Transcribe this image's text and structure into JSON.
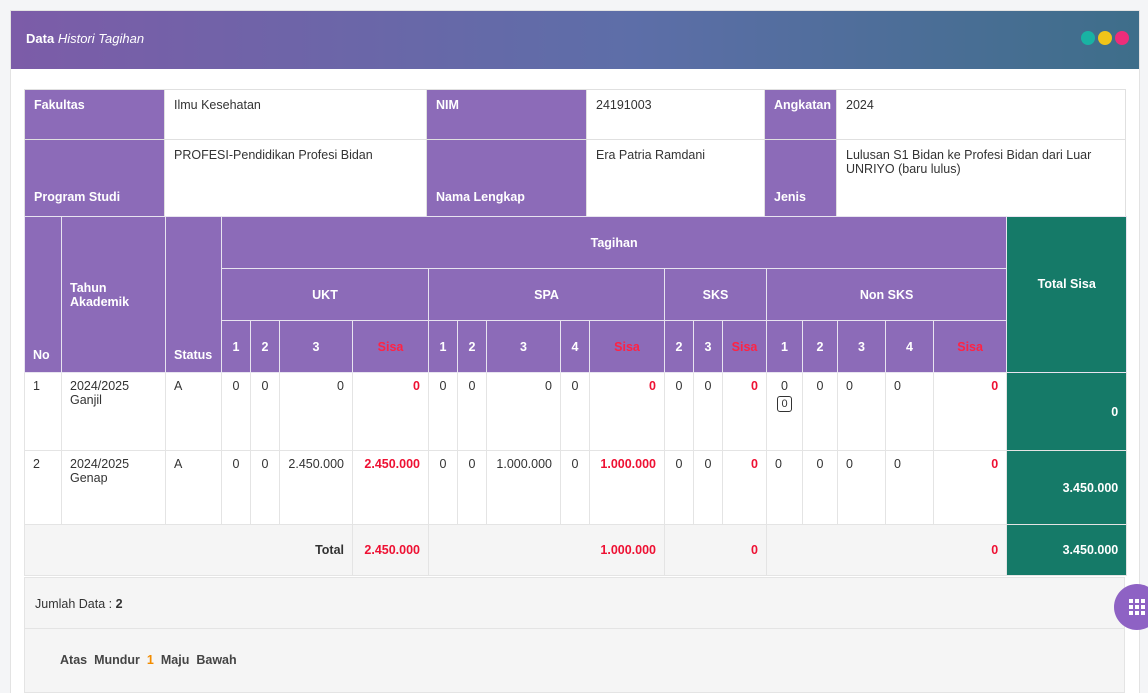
{
  "header": {
    "title_bold": "Data",
    "title_italic": "Histori Tagihan"
  },
  "colors": {
    "dot1": "#19b3a3",
    "dot2": "#f0c419",
    "dot3": "#ee2d7a",
    "header_purple": "#8c6bb8",
    "green": "#157a68",
    "red": "#ee1133",
    "pager_active": "#f28c00"
  },
  "info": {
    "fakultas_label": "Fakultas",
    "fakultas_value": "Ilmu Kesehatan",
    "nim_label": "NIM",
    "nim_value": "24191003",
    "angkatan_label": "Angkatan",
    "angkatan_value": "2024",
    "prodi_label": "Program Studi",
    "prodi_value": "PROFESI-Pendidikan Profesi Bidan",
    "nama_label": "Nama Lengkap",
    "nama_value": "Era Patria Ramdani",
    "jenis_label": "Jenis",
    "jenis_value": "Lulusan S1 Bidan ke Profesi Bidan dari Luar UNRIYO (baru lulus)"
  },
  "table": {
    "h_no": "No",
    "h_tahun": "Tahun Akademik",
    "h_status": "Status",
    "h_tagihan": "Tagihan",
    "h_total_sisa": "Total Sisa",
    "h_ukt": "UKT",
    "h_spa": "SPA",
    "h_sks": "SKS",
    "h_nonsks": "Non SKS",
    "ukt_cols": [
      "1",
      "2",
      "3",
      "Sisa"
    ],
    "spa_cols": [
      "1",
      "2",
      "3",
      "4",
      "Sisa"
    ],
    "sks_cols": [
      "2",
      "3",
      "Sisa"
    ],
    "nonsks_cols": [
      "1",
      "2",
      "3",
      "4",
      "Sisa"
    ],
    "rows": [
      {
        "no": "1",
        "tahun": "2024/2025 Ganjil",
        "status": "A",
        "ukt": [
          "0",
          "0",
          "0",
          "0"
        ],
        "spa": [
          "0",
          "0",
          "0",
          "0",
          "0"
        ],
        "sks": [
          "0",
          "0",
          "0"
        ],
        "nonsks": [
          "0",
          "0",
          "0",
          "0",
          "0"
        ],
        "edit_value": "0",
        "total_sisa": "0"
      },
      {
        "no": "2",
        "tahun": "2024/2025 Genap",
        "status": "A",
        "ukt": [
          "0",
          "0",
          "2.450.000",
          "2.450.000"
        ],
        "spa": [
          "0",
          "0",
          "1.000.000",
          "0",
          "1.000.000"
        ],
        "sks": [
          "0",
          "0",
          "0"
        ],
        "nonsks": [
          "0",
          "0",
          "0",
          "0",
          "0"
        ],
        "total_sisa": "3.450.000"
      }
    ],
    "total": {
      "label": "Total",
      "ukt": "2.450.000",
      "spa": "1.000.000",
      "sks": "0",
      "nonsks": "0",
      "total_sisa": "3.450.000"
    }
  },
  "footer": {
    "jumlah_label": "Jumlah Data : ",
    "jumlah_value": "2"
  },
  "pager": {
    "atas": "Atas",
    "mundur": "Mundur",
    "current": "1",
    "maju": "Maju",
    "bawah": "Bawah"
  },
  "fab": {
    "icon": "grid-icon"
  }
}
